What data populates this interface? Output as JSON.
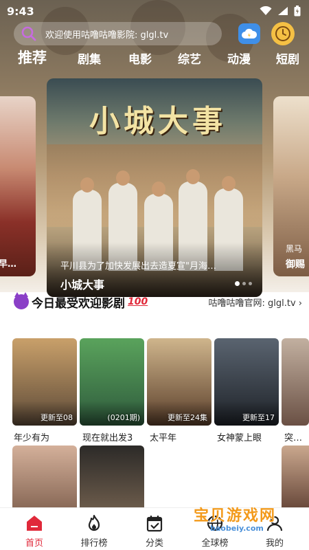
{
  "status": {
    "time": "9:43"
  },
  "search": {
    "text": "欢迎使用咕噜咕噜影院: glgl.tv"
  },
  "tabs": [
    "推荐",
    "剧集",
    "电影",
    "综艺",
    "动漫",
    "短剧"
  ],
  "banner": {
    "art_title": "小城大事",
    "description": "平川县为了加快发展出去造夏宣\"月海…",
    "title": "小城大事",
    "left_card": {
      "caption": "早…"
    },
    "right_card": {
      "sub": "黑马",
      "caption": "御赐"
    }
  },
  "section": {
    "title": "今日最受欢迎影剧",
    "hundred": "100",
    "link": "咕噜咕噜官网: glgl.tv",
    "link_chevron": "›"
  },
  "movies": [
    {
      "title": "年少有为",
      "badge": "更新至08",
      "color_top": "#c9a06a",
      "color_bottom": "#5d4a38"
    },
    {
      "title": "现在就出发3",
      "badge": "(0201期)",
      "color_top": "#5aa35c",
      "color_bottom": "#2e5a3c"
    },
    {
      "title": "太平年",
      "badge": "更新至24集",
      "color_top": "#cfb58c",
      "color_bottom": "#5a3e2a"
    },
    {
      "title": "女神蒙上眼",
      "badge": "更新至17",
      "color_top": "#5a6470",
      "color_bottom": "#1e2228"
    },
    {
      "title": "突…",
      "badge": "",
      "color_top": "#c2b0a0",
      "color_bottom": "#6a5044"
    }
  ],
  "nav": [
    {
      "label": "首页",
      "icon": "home-icon",
      "active": true
    },
    {
      "label": "排行榜",
      "icon": "flame-icon",
      "active": false
    },
    {
      "label": "分类",
      "icon": "calendar-icon",
      "active": false
    },
    {
      "label": "全球榜",
      "icon": "globe-icon",
      "active": false
    },
    {
      "label": "我的",
      "icon": "user-icon",
      "active": false
    }
  ],
  "watermark": {
    "text": "宝贝游戏网",
    "url": "baobeiy.com"
  },
  "colors": {
    "accent": "#e0293a",
    "search_icon": "#c76be0",
    "cloud": "#3f8fe8",
    "clock": "#f5c044"
  }
}
